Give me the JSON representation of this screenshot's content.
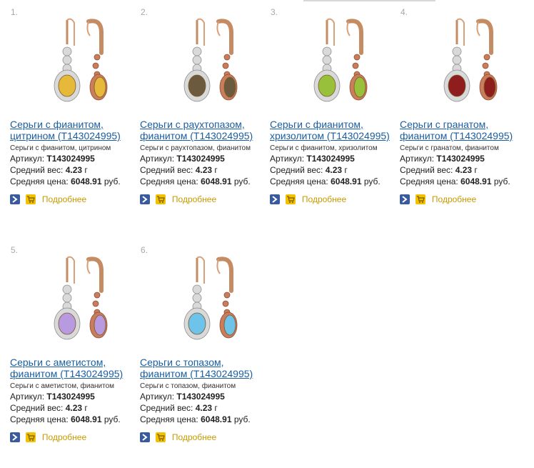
{
  "products": [
    {
      "num": "1.",
      "title_line1": "Серьги с фианитом,",
      "title_line2": "цитрином (Т143024995)",
      "subtitle": "Серьги с фианитом, цитрином",
      "article_label": "Артикул:",
      "article_value": "Т143024995",
      "weight_label": "Средний вес:",
      "weight_value": "4.23",
      "weight_unit": "г",
      "price_label": "Средняя цена:",
      "price_value": "6048.91",
      "price_unit": "руб.",
      "more_label": "Подробнее",
      "gem_color": "#e7b93a"
    },
    {
      "num": "2.",
      "title_line1": "Серьги с раухтопазом,",
      "title_line2": "фианитом (Т143024995)",
      "subtitle": "Серьги с раухтопазом, фианитом",
      "article_label": "Артикул:",
      "article_value": "Т143024995",
      "weight_label": "Средний вес:",
      "weight_value": "4.23",
      "weight_unit": "г",
      "price_label": "Средняя цена:",
      "price_value": "6048.91",
      "price_unit": "руб.",
      "more_label": "Подробнее",
      "gem_color": "#6b5a3e"
    },
    {
      "num": "3.",
      "title_line1": "Серьги с фианитом,",
      "title_line2": "хризолитом (Т143024995)",
      "subtitle": "Серьги с фианитом, хризолитом",
      "article_label": "Артикул:",
      "article_value": "Т143024995",
      "weight_label": "Средний вес:",
      "weight_value": "4.23",
      "weight_unit": "г",
      "price_label": "Средняя цена:",
      "price_value": "6048.91",
      "price_unit": "руб.",
      "more_label": "Подробнее",
      "gem_color": "#98c03a"
    },
    {
      "num": "4.",
      "title_line1": "Серьги с гранатом,",
      "title_line2": "фианитом (Т143024995)",
      "subtitle": "Серьги с гранатом, фианитом",
      "article_label": "Артикул:",
      "article_value": "Т143024995",
      "weight_label": "Средний вес:",
      "weight_value": "4.23",
      "weight_unit": "г",
      "price_label": "Средняя цена:",
      "price_value": "6048.91",
      "price_unit": "руб.",
      "more_label": "Подробнее",
      "gem_color": "#8e1d1d"
    },
    {
      "num": "5.",
      "title_line1": "Серьги с аметистом,",
      "title_line2": "фианитом (Т143024995)",
      "subtitle": "Серьги с аметистом, фианитом",
      "article_label": "Артикул:",
      "article_value": "Т143024995",
      "weight_label": "Средний вес:",
      "weight_value": "4.23",
      "weight_unit": "г",
      "price_label": "Средняя цена:",
      "price_value": "6048.91",
      "price_unit": "руб.",
      "more_label": "Подробнее",
      "gem_color": "#b79ae0"
    },
    {
      "num": "6.",
      "title_line1": "Серьги с топазом,",
      "title_line2": "фианитом (Т143024995)",
      "subtitle": "Серьги с топазом, фианитом",
      "article_label": "Артикул:",
      "article_value": "Т143024995",
      "weight_label": "Средний вес:",
      "weight_value": "4.23",
      "weight_unit": "г",
      "price_label": "Средняя цена:",
      "price_value": "6048.91",
      "price_unit": "руб.",
      "more_label": "Подробнее",
      "gem_color": "#6ec3ea"
    }
  ],
  "icons": {
    "go": "arrow-right-icon",
    "cart": "cart-icon"
  }
}
